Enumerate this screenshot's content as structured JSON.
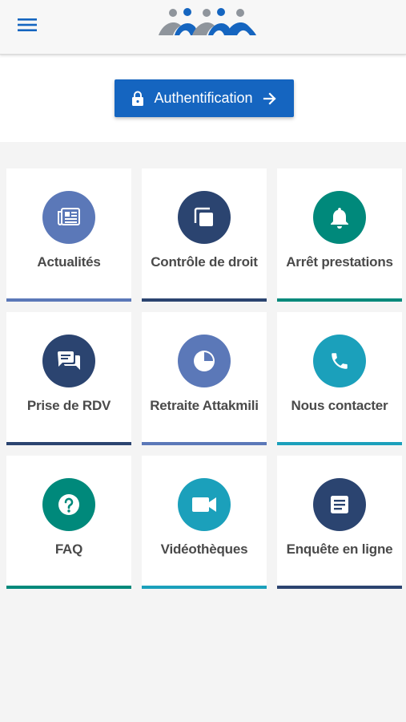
{
  "header": {
    "menu_icon": "hamburger-menu-icon",
    "logo_icon": "cnss-logo-icon",
    "colors": {
      "menu": "#1565c0",
      "logo_grey": "#8f959c",
      "logo_blue": "#1565c0"
    }
  },
  "auth": {
    "label": "Authentification",
    "left_icon": "lock-icon",
    "right_icon": "arrow-right-icon",
    "color": "#1565c0"
  },
  "tiles": [
    {
      "label": "Actualités",
      "icon": "newspaper-icon",
      "color": "#5b78b8"
    },
    {
      "label": "Contrôle de droit",
      "icon": "copy-icon",
      "color": "#2b4470"
    },
    {
      "label": "Arrêt prestations",
      "icon": "bell-icon",
      "color": "#00897b"
    },
    {
      "label": "Prise de RDV",
      "icon": "chat-icon",
      "color": "#2b4470"
    },
    {
      "label": "Retraite Attakmili",
      "icon": "pie-chart-icon",
      "color": "#5b78b8"
    },
    {
      "label": "Nous contacter",
      "icon": "phone-icon",
      "color": "#1ba0bb"
    },
    {
      "label": "FAQ",
      "icon": "help-icon",
      "color": "#00897b"
    },
    {
      "label": "Vidéothèques",
      "icon": "videocam-icon",
      "color": "#1ba0bb"
    },
    {
      "label": "Enquête en ligne",
      "icon": "article-icon",
      "color": "#2b4470"
    }
  ]
}
